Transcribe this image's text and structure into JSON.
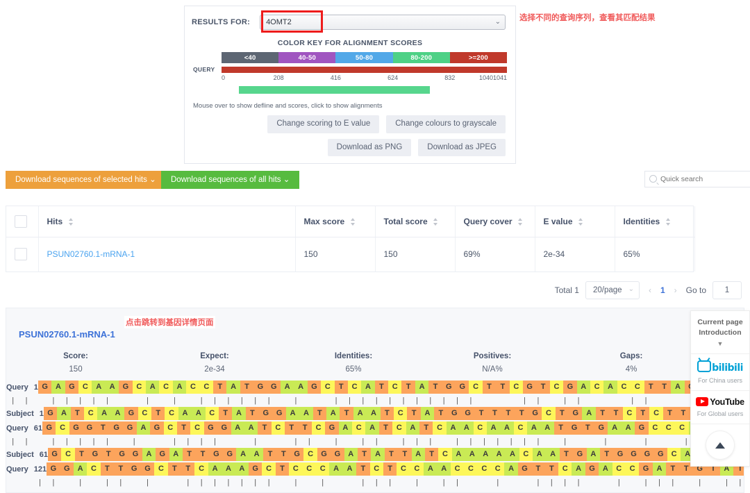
{
  "blast_graphic": {
    "results_for_label": "RESULTS FOR:",
    "selected_query": "4OMT2",
    "color_key_title": "COLOR KEY FOR ALIGNMENT SCORES",
    "key_segments": [
      {
        "label": "<40",
        "color": "#5d6673"
      },
      {
        "label": "40-50",
        "color": "#a055c0"
      },
      {
        "label": "50-80",
        "color": "#52a8e8"
      },
      {
        "label": "80-200",
        "color": "#4ed186"
      },
      {
        "label": ">=200",
        "color": "#c0392b"
      }
    ],
    "query_label": "QUERY",
    "query_bar_color": "#c0392b",
    "ticks": [
      "0",
      "208",
      "416",
      "624",
      "832",
      "10401041"
    ],
    "hit_bar": {
      "color": "#57d68d",
      "left_pct": 6,
      "width_pct": 67
    },
    "mouseover_note": "Mouse over to show defline and scores, click to show alignments",
    "buttons": [
      "Change scoring to E value",
      "Change colours to grayscale",
      "Download as PNG",
      "Download as JPEG"
    ],
    "annotation_cn": "选择不同的查询序列，查看其匹配结果"
  },
  "actions": {
    "download_selected": "Download sequences of selected hits ⌄",
    "download_selected_color": "#eda03c",
    "download_all": "Download sequences of all hits ⌄",
    "download_all_color": "#57bb3f",
    "quick_search_placeholder": "Quick search"
  },
  "hits_table": {
    "columns": [
      "Hits",
      "Max score",
      "Total score",
      "Query cover",
      "E value",
      "Identities"
    ],
    "rows": [
      {
        "hit": "PSUN02760.1-mRNA-1",
        "max_score": "150",
        "total_score": "150",
        "query_cover": "69%",
        "e_value": "2e-34",
        "identities": "65%"
      }
    ]
  },
  "pagination": {
    "total": "Total 1",
    "page_size": "20/page",
    "prev": "‹",
    "current_page": "1",
    "next": "›",
    "goto_label": "Go to",
    "goto_value": "1"
  },
  "alignment": {
    "title": "PSUN02760.1-mRNA-1",
    "annotation_cn": "点击跳转到基因详情页面",
    "stats": [
      {
        "key": "Score:",
        "value": "150"
      },
      {
        "key": "Expect:",
        "value": "2e-34"
      },
      {
        "key": "Identities:",
        "value": "65%"
      },
      {
        "key": "Positives:",
        "value": "N/A%"
      },
      {
        "key": "Gaps:",
        "value": "4%"
      }
    ],
    "query_label": "Query",
    "subject_label": "Subject",
    "blocks": [
      {
        "query_pos": "1",
        "subject_pos": "1",
        "query": "GAGCAAGCACACCTATGGAAGCTCATCTATGGCTTCGTCGACACCTTAGTCGTTAGATC",
        "subject": "GATCAAGCTCAACTATGGAATATAATCTATGGTTTTGCTGATTCTCTTGTTCTTCGCTG",
        "match": "||.|||||..|.|.||||||.|..|||||||||||...||.||...||...||..|.||"
      },
      {
        "query_pos": "61",
        "subject_pos": "61",
        "query": "GCGGTGGAGCTCGGAATCTTCGACATCATCAACAACAATGTGAAGCCCATGACA-GTGT",
        "subject": "GCTGTGGAGATTGGAATTGCGGATATTATCAAAAACAATGATGGGGCAATCACACTTGCA",
        "match": "||.|||||.|..||||..|..||.|.||.|||.|||||||.|..|..|..|.|..||.|"
      },
      {
        "query_pos": "121",
        "subject_pos": "",
        "query": "GGACTTGGCTTCAAAGCTCCCAATCTCCAACCCCAGTTCAGACCGATTGTATCGAATTC",
        "subject": "",
        "match": "..||.|.||.|..|||||||.|.|..|||.|.||..|..||||..|.|||.|.|||.|."
      }
    ]
  },
  "side_widget": {
    "title_line1": "Current page",
    "title_line2": "Introduction",
    "caret": "▼",
    "bilibili_label": "bilibili",
    "bilibili_sub": "For China users",
    "youtube_label": "YouTube",
    "youtube_sub": "For Global users"
  }
}
